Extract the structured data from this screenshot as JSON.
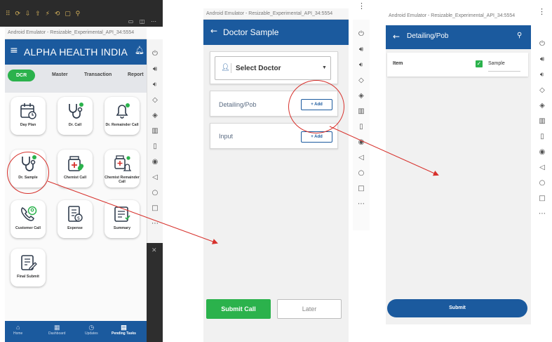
{
  "panel1": {
    "emulator_title": "Android Emulator - Resizable_Experimental_API_34:5554",
    "app_title": "ALPHA HEALTH INDIA",
    "tabs": [
      {
        "label": "DCR",
        "active": true
      },
      {
        "label": "Master",
        "active": false
      },
      {
        "label": "Transaction",
        "active": false
      },
      {
        "label": "Report",
        "active": false
      }
    ],
    "tiles": [
      {
        "label": "Day Plan",
        "icon": "calendar-icon"
      },
      {
        "label": "Dr. Call",
        "icon": "stethoscope-icon"
      },
      {
        "label": "Dr. Remainder Call",
        "icon": "bell-icon"
      },
      {
        "label": "Dr. Sample",
        "icon": "stethoscope-icon"
      },
      {
        "label": "Chemist Call",
        "icon": "medicine-box-icon"
      },
      {
        "label": "Chemist Remainder Call",
        "icon": "medicine-bell-icon"
      },
      {
        "label": "Customer Call",
        "icon": "phone-person-icon"
      },
      {
        "label": "Expense",
        "icon": "expense-icon"
      },
      {
        "label": "Summary",
        "icon": "summary-icon"
      },
      {
        "label": "Final Submit",
        "icon": "clipboard-edit-icon"
      }
    ],
    "bottom_nav": [
      {
        "label": "Home",
        "icon": "home-icon",
        "active": false
      },
      {
        "label": "Dashboard",
        "icon": "dashboard-icon",
        "active": false
      },
      {
        "label": "Updates",
        "icon": "updates-icon",
        "active": false
      },
      {
        "label": "Pending Tasks",
        "icon": "tasks-icon",
        "active": true
      }
    ]
  },
  "panel2": {
    "emulator_title": "Android Emulator - Resizable_Experimental_API_34:5554",
    "screen_title": "Doctor Sample",
    "select_placeholder": "Select Doctor",
    "sections": [
      {
        "label": "Detailing/Pob",
        "button": "+ Add"
      },
      {
        "label": "Input",
        "button": "+ Add"
      }
    ],
    "submit_label": "Submit Call",
    "later_label": "Later"
  },
  "panel3": {
    "emulator_title": "Android Emulator - Resizable_Experimental_API_34:5554",
    "screen_title": "Detailing/Pob",
    "row_label": "Item",
    "checkbox_label": "Sample",
    "checkbox_checked": true,
    "submit_label": "Submit"
  },
  "colors": {
    "primary_blue": "#1b5a9e",
    "accent_green": "#2bb24c",
    "annotation_red": "#d7312c"
  }
}
